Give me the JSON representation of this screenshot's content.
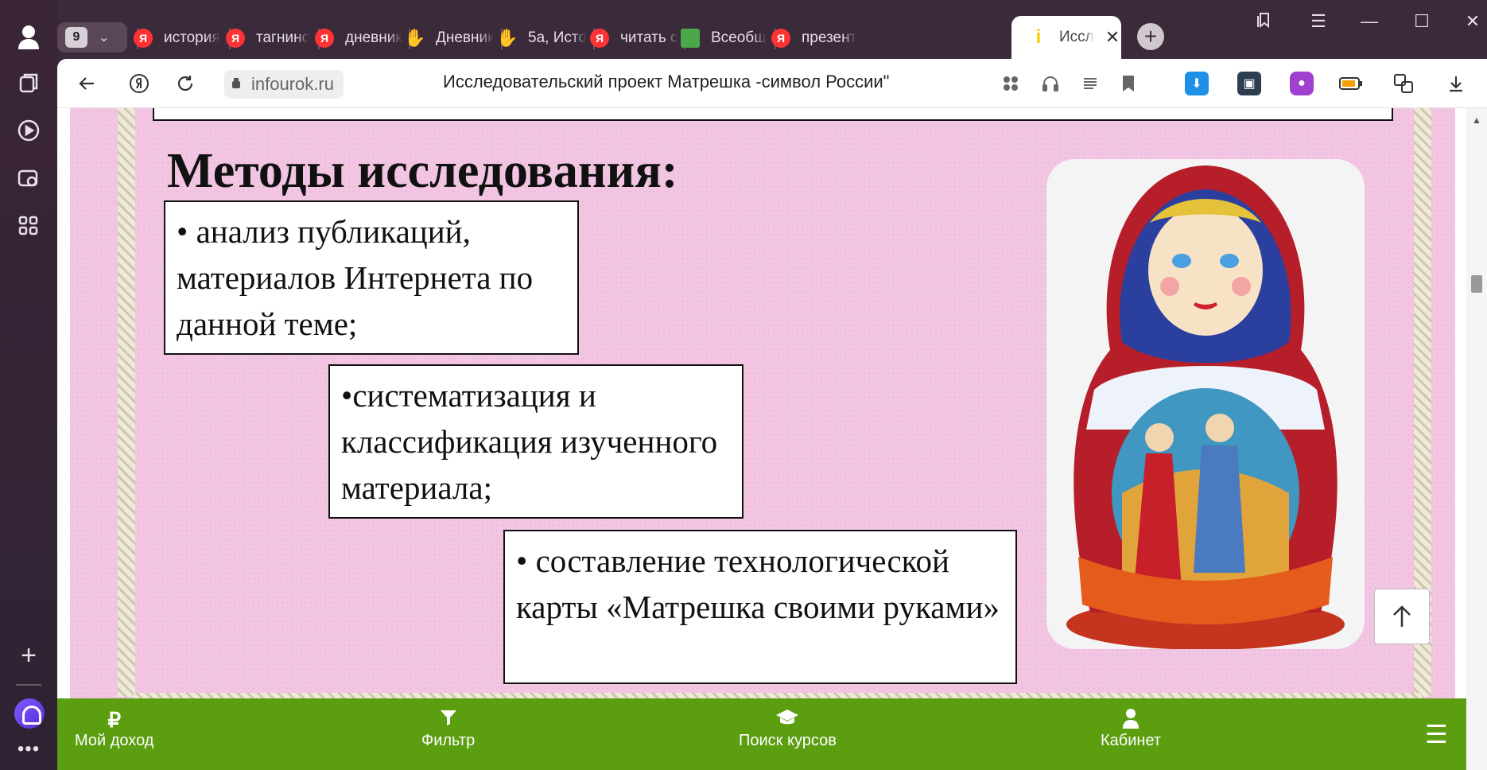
{
  "tabstrip": {
    "tab_count": "9",
    "tabs": [
      {
        "label": "история",
        "icon": "yandex-icon"
      },
      {
        "label": "тагнинс",
        "icon": "yandex-icon"
      },
      {
        "label": "дневник",
        "icon": "yandex-icon"
      },
      {
        "label": "Дневник",
        "icon": "hand-icon"
      },
      {
        "label": "5а, Исто",
        "icon": "hand-icon"
      },
      {
        "label": "читать с",
        "icon": "yandex-icon"
      },
      {
        "label": "Всеобщ",
        "icon": "book-icon"
      },
      {
        "label": "презент",
        "icon": "yandex-icon"
      }
    ],
    "active_tab": {
      "label": "Иссл",
      "icon": "infourok-icon"
    },
    "yandex_glyph": "Я",
    "info_glyph": "i"
  },
  "toolbar": {
    "domain": "infourok.ru",
    "page_title": "Исследовательский проект Матрешка -символ России\""
  },
  "slide": {
    "heading": "Методы исследования:",
    "boxes": [
      "• анализ публикаций, материалов Интернета по данной теме;",
      "•систематизация и классификация изученного материала;",
      "• составление технологической карты «Матрешка своими руками»"
    ]
  },
  "bottomnav": {
    "items": [
      {
        "label": "Мой доход",
        "icon": "ruble-icon",
        "glyph": "₽"
      },
      {
        "label": "Фильтр",
        "icon": "filter-icon",
        "glyph": ""
      },
      {
        "label": "Поиск курсов",
        "icon": "graduation-cap-icon",
        "glyph": ""
      },
      {
        "label": "Кабинет",
        "icon": "user-icon",
        "glyph": ""
      }
    ]
  },
  "colors": {
    "nav_green": "#5b9e10",
    "slide_pink": "#f2c6e3",
    "chrome_dark": "#3b2a3a"
  }
}
